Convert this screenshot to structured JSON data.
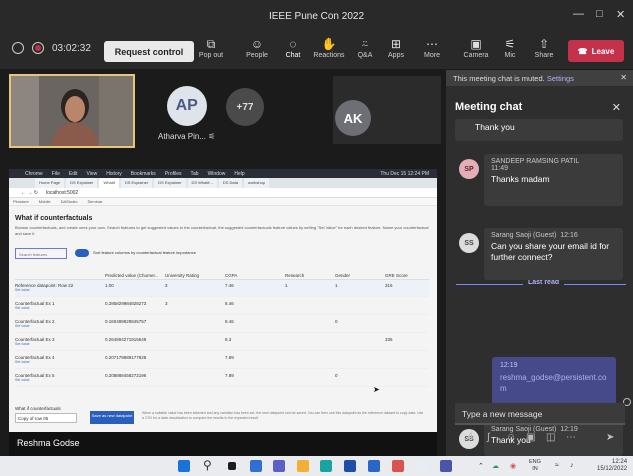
{
  "window": {
    "title": "IEEE Pune Con 2022"
  },
  "toolbar": {
    "timer": "03:02:32",
    "request_control": "Request control",
    "items": [
      {
        "icon": "popout-icon",
        "label": "Pop out"
      },
      {
        "icon": "people-icon",
        "label": "People"
      },
      {
        "icon": "chat-icon",
        "label": "Chat"
      },
      {
        "icon": "reactions-icon",
        "label": "Reactions"
      },
      {
        "icon": "qa-icon",
        "label": "Q&A"
      },
      {
        "icon": "apps-icon",
        "label": "Apps"
      },
      {
        "icon": "more-icon",
        "label": "More"
      },
      {
        "icon": "camera-off-icon",
        "label": "Camera"
      },
      {
        "icon": "mic-off-icon",
        "label": "Mic"
      },
      {
        "icon": "share-icon",
        "label": "Share"
      }
    ],
    "leave": "Leave"
  },
  "stage": {
    "participants": [
      {
        "initials": "AP",
        "name": "Atharva Pin...",
        "color": "#dfe3ea"
      },
      {
        "initials": "+77",
        "name": "",
        "color": "#4a4a4a"
      },
      {
        "initials": "AK",
        "name": "",
        "color": "#6e6f75"
      }
    ],
    "presenter": "Reshma Godse"
  },
  "shared_screen": {
    "mac_menu": [
      "Chrome",
      "File",
      "Edit",
      "View",
      "History",
      "Bookmarks",
      "Profiles",
      "Tab",
      "Window",
      "Help"
    ],
    "mac_clock": "Thu Dec 15 12:24 PM",
    "tabs": [
      "Home Page",
      "DS Explainer",
      "Whatif",
      "DS Explainer",
      "DS Explainer",
      "DS Whatif...",
      "DS Data",
      "workshop"
    ],
    "url": "localhost:5002",
    "bookmarks": [
      "Pimstore",
      "Mobile",
      "DAStudio",
      "Seminar"
    ],
    "title": "What if counterfactuals",
    "description": "Browse counterfactuals, and create ones your own. Search features to get suggested values to the counterfactual, the suggested counterfactuals feature values by setting \"Set Value\" for each desired feature. Name your counterfactual and save it.",
    "search_placeholder": "Search features",
    "toggle_label": "Sort feature columns by counterfactual feature importance",
    "columns": [
      "",
      "Predicted value (Churner...",
      "University Rating",
      "CGPA",
      "Research",
      "Gender",
      "GRE Score"
    ],
    "rows": [
      {
        "name": "Reference datapoint: Row 22",
        "sub": "Set value",
        "cells": [
          "1.00",
          "3",
          "7.46",
          "1",
          "1",
          "315"
        ]
      },
      {
        "name": "Counterfactual Ex 1",
        "sub": "Set value",
        "cells": [
          "0.285829984828273",
          "3",
          "8.46",
          "",
          "",
          ""
        ]
      },
      {
        "name": "Counterfactual Ex 2",
        "sub": "Set value",
        "cells": [
          "0.160489829845757",
          "",
          "8.46",
          "",
          "0",
          ""
        ]
      },
      {
        "name": "Counterfactual Ex 3",
        "sub": "Set value",
        "cells": [
          "0.264894271915649",
          "",
          "8.3",
          "",
          "",
          "336"
        ]
      },
      {
        "name": "Counterfactual Ex 4",
        "sub": "Set value",
        "cells": [
          "0.207179989177928",
          "",
          "7.89",
          "",
          "",
          ""
        ]
      },
      {
        "name": "Counterfactual Ex 5",
        "sub": "Set value",
        "cells": [
          "0.208888458272196",
          "",
          "7.89",
          "",
          "0",
          ""
        ]
      }
    ],
    "footer_label": "What if counterfactuals",
    "footer_input": "Copy of row 05",
    "footer_button": "Save as new datapoint",
    "footer_text": "When a suitable value has been selected and any variation has been set, the new datapoint can be saved. You can then use this datapoint as the reference dataset to copy data. Use a CSV for a data visualization to compare the results to the expected result."
  },
  "chat": {
    "mute_notice": "This meeting chat is muted.",
    "mute_settings": "Settings",
    "title": "Meeting chat",
    "last_read": "Last read",
    "messages": [
      {
        "initials": "",
        "sender": "",
        "time": "",
        "text": "Thank you"
      },
      {
        "initials": "SP",
        "sender": "SANDEEP RAMSING PATIL",
        "time": "11:49",
        "text": "Thanks madam"
      },
      {
        "initials": "SS",
        "sender": "Sarang Saoji (Guest)",
        "time": "12:16",
        "text": "Can you share your email id for further connect?"
      },
      {
        "initials": "",
        "sender": "",
        "time": "12:19",
        "text": "reshma_godse@persistent.com"
      },
      {
        "initials": "SS",
        "sender": "Sarang Saoji (Guest)",
        "time": "12:19",
        "text": "Thank you"
      }
    ],
    "compose_placeholder": "Type a new message",
    "compose_tools": [
      "format-icon",
      "attach-icon",
      "emoji-icon",
      "gif-icon",
      "sticker-icon",
      "more-options-icon",
      "send-icon"
    ]
  },
  "taskbar": {
    "lang_top": "ENG",
    "lang_bottom": "IN",
    "time": "12:24",
    "date": "15/12/2022"
  },
  "colors": {
    "leave": "#c4314b",
    "accent": "#7f85f5",
    "own_message": "#474a8a",
    "frame": "#e7c57a"
  }
}
